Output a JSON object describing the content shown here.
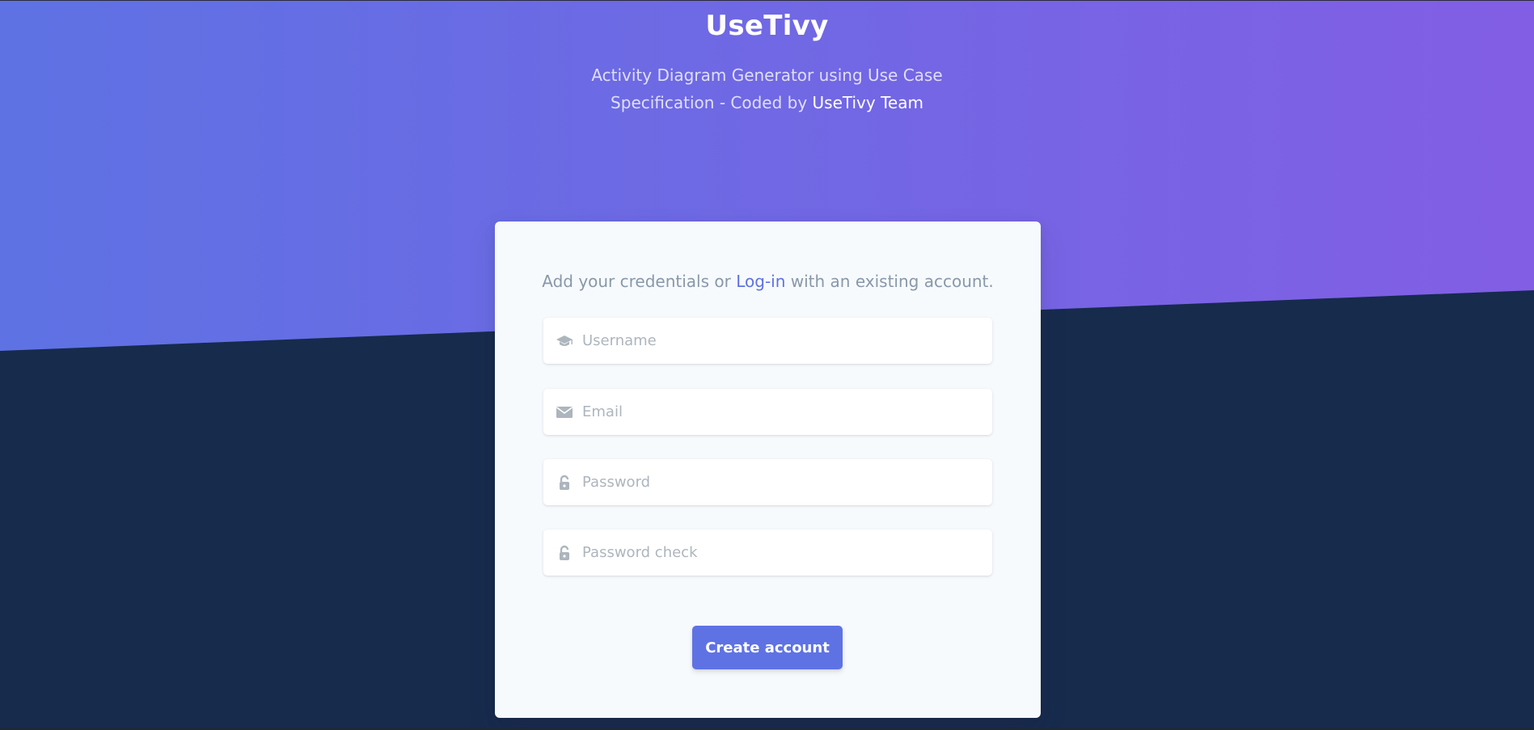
{
  "header": {
    "title": "UseTivy",
    "subtitle_prefix": "Activity Diagram Generator using Use Case Specification - Coded by",
    "subtitle_team": "UseTivy Team"
  },
  "card": {
    "intro_before": "Add your credentials or",
    "intro_link": "Log-in",
    "intro_after": "with an existing account.",
    "fields": [
      {
        "placeholder": "Username",
        "icon": "graduation-cap-icon"
      },
      {
        "placeholder": "Email",
        "icon": "envelope-icon"
      },
      {
        "placeholder": "Password",
        "icon": "unlock-icon"
      },
      {
        "placeholder": "Password check",
        "icon": "unlock-icon"
      }
    ],
    "submit_label": "Create account"
  },
  "colors": {
    "primary": "#5e72e4",
    "gradient_end": "#825ee4",
    "dark_bg": "#172b4d",
    "card_bg": "#f7fafc",
    "muted_text": "#8898aa",
    "icon_gray": "#adb5bd"
  }
}
